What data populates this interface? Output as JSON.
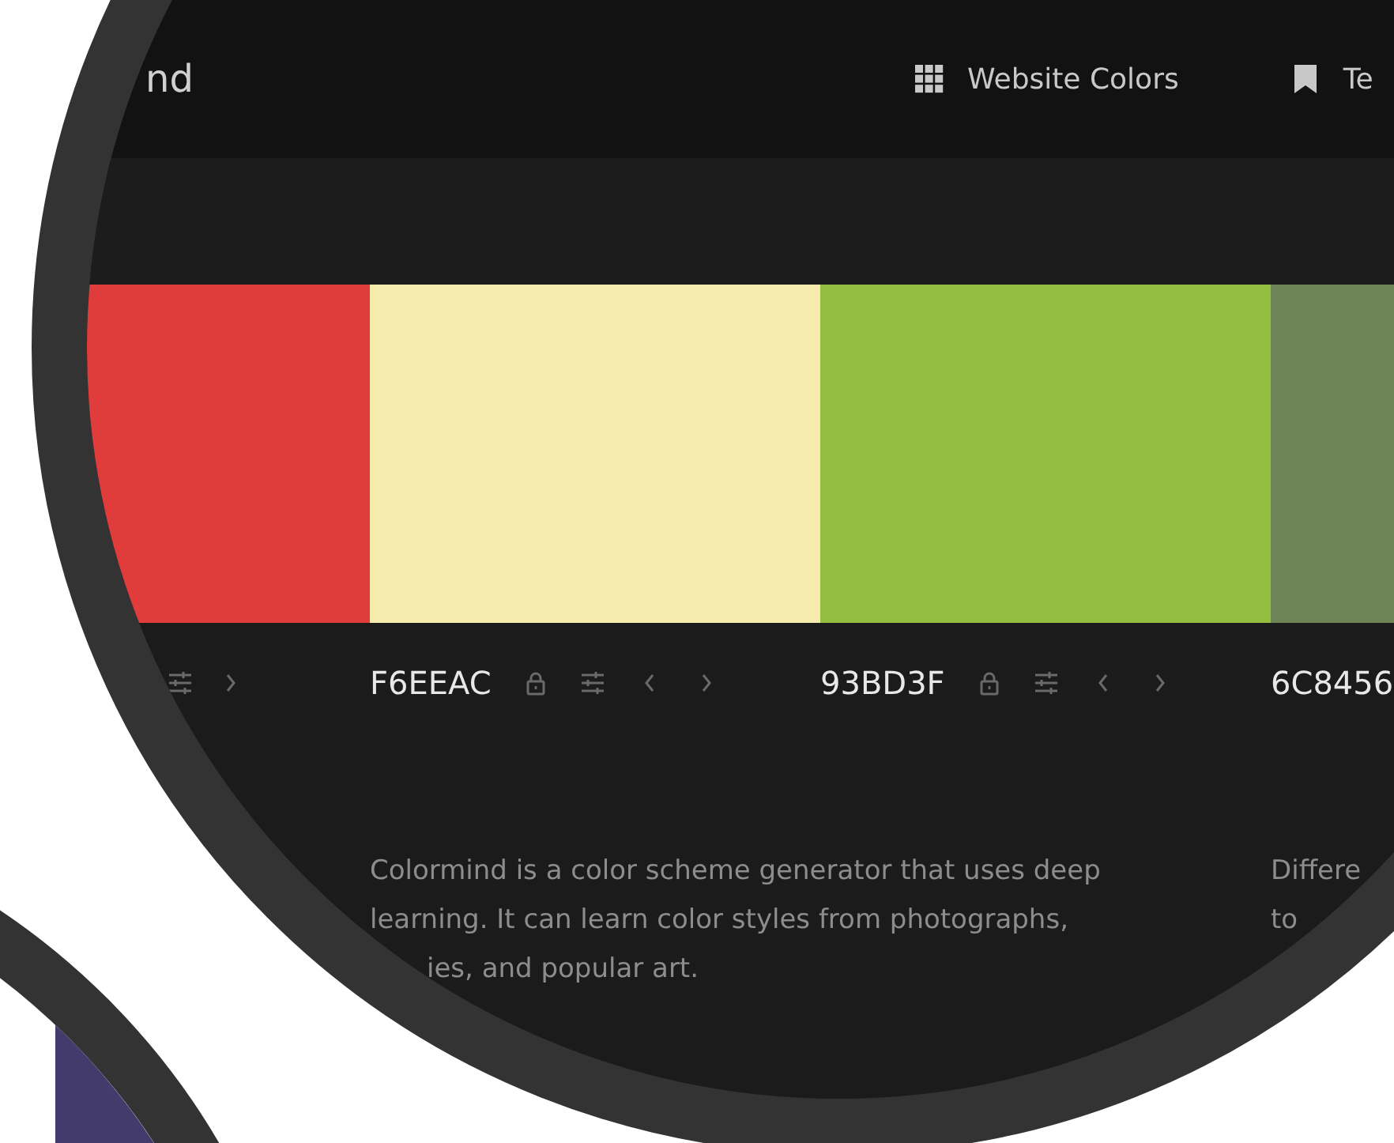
{
  "header": {
    "logo_text": "nd",
    "nav": [
      {
        "kind": "grid",
        "label": "Website Colors"
      },
      {
        "kind": "bookmark",
        "label": "Te"
      }
    ]
  },
  "palette": [
    {
      "color": "#e03c3c"
    },
    {
      "color": "#f4ebac",
      "hex": "F6EEAC"
    },
    {
      "color": "#93bd3f",
      "hex": "93BD3F"
    },
    {
      "color": "#6c8456",
      "hex": "6C8456"
    }
  ],
  "about": {
    "paragraph_lines": [
      "Colormind is a color scheme generator that uses deep",
      "learning. It can learn color styles from photographs,",
      "ies, and popular art."
    ],
    "second_lines": [
      "Differe",
      "to"
    ]
  }
}
